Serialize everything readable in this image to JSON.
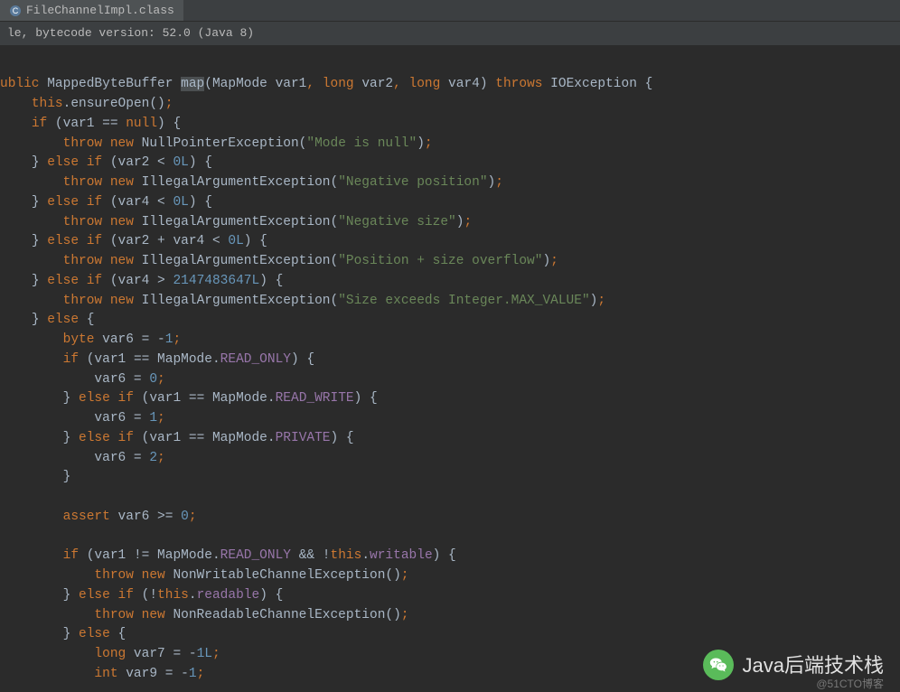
{
  "tab": {
    "filename": "FileChannelImpl.class"
  },
  "decompile_info": "le, bytecode version: 52.0 (Java 8)",
  "code": {
    "line1": {
      "kw1": "ublic",
      "type1": "MappedByteBuffer",
      "method": "map",
      "t1": "(MapMode var1",
      "kw2": ",",
      "t2": " long ",
      "v2": "var2",
      "t3": ", long ",
      "v3": "var4",
      "t4": ") ",
      "kw3": "throws",
      "t5": " IOException {"
    },
    "line2": {
      "kw1": "this",
      "t1": ".ensureOpen()",
      "p": ";"
    },
    "line3": {
      "kw1": "if",
      "t1": " (var1 == ",
      "kw2": "null",
      "t2": ") {"
    },
    "line4": {
      "kw1": "throw new",
      "t1": " NullPointerException(",
      "s1": "\"Mode is null\"",
      "t2": ")",
      "p": ";"
    },
    "line5": {
      "t1": "} ",
      "kw1": "else if",
      "t2": " (var2 < ",
      "n1": "0L",
      "t3": ") {"
    },
    "line6": {
      "kw1": "throw new",
      "t1": " IllegalArgumentException(",
      "s1": "\"Negative position\"",
      "t2": ")",
      "p": ";"
    },
    "line7": {
      "t1": "} ",
      "kw1": "else if",
      "t2": " (var4 < ",
      "n1": "0L",
      "t3": ") {"
    },
    "line8": {
      "kw1": "throw new",
      "t1": " IllegalArgumentException(",
      "s1": "\"Negative size\"",
      "t2": ")",
      "p": ";"
    },
    "line9": {
      "t1": "} ",
      "kw1": "else if",
      "t2": " (var2 + var4 < ",
      "n1": "0L",
      "t3": ") {"
    },
    "line10": {
      "kw1": "throw new",
      "t1": " IllegalArgumentException(",
      "s1": "\"Position + size overflow\"",
      "t2": ")",
      "p": ";"
    },
    "line11": {
      "t1": "} ",
      "kw1": "else if",
      "t2": " (var4 > ",
      "n1": "2147483647L",
      "t3": ") {"
    },
    "line12": {
      "kw1": "throw new",
      "t1": " IllegalArgumentException(",
      "s1": "\"Size exceeds Integer.MAX_VALUE\"",
      "t2": ")",
      "p": ";"
    },
    "line13": {
      "t1": "} ",
      "kw1": "else",
      "t2": " {"
    },
    "line14": {
      "kw1": "byte",
      "t1": " var6 = -",
      "n1": "1",
      "p": ";"
    },
    "line15": {
      "kw1": "if",
      "t1": " (var1 == MapMode.",
      "f1": "READ_ONLY",
      "t2": ") {"
    },
    "line16": {
      "t1": "var6 = ",
      "n1": "0",
      "p": ";"
    },
    "line17": {
      "t1": "} ",
      "kw1": "else if",
      "t2": " (var1 == MapMode.",
      "f1": "READ_WRITE",
      "t3": ") {"
    },
    "line18": {
      "t1": "var6 = ",
      "n1": "1",
      "p": ";"
    },
    "line19": {
      "t1": "} ",
      "kw1": "else if",
      "t2": " (var1 == MapMode.",
      "f1": "PRIVATE",
      "t3": ") {"
    },
    "line20": {
      "t1": "var6 = ",
      "n1": "2",
      "p": ";"
    },
    "line21": {
      "t1": "}"
    },
    "line22": {
      "t1": ""
    },
    "line23": {
      "kw1": "assert",
      "t1": " var6 >= ",
      "n1": "0",
      "p": ";"
    },
    "line24": {
      "t1": ""
    },
    "line25": {
      "kw1": "if",
      "t1": " (var1 != MapMode.",
      "f1": "READ_ONLY",
      "t2": " && !",
      "kw2": "this",
      "t3": ".",
      "f2": "writable",
      "t4": ") {"
    },
    "line26": {
      "kw1": "throw new",
      "t1": " NonWritableChannelException()",
      "p": ";"
    },
    "line27": {
      "t1": "} ",
      "kw1": "else if",
      "t2": " (!",
      "kw2": "this",
      "t3": ".",
      "f1": "readable",
      "t4": ") {"
    },
    "line28": {
      "kw1": "throw new",
      "t1": " NonReadableChannelException()",
      "p": ";"
    },
    "line29": {
      "t1": "} ",
      "kw1": "else",
      "t2": " {"
    },
    "line30": {
      "kw1": "long",
      "t1": " var7 = -",
      "n1": "1L",
      "p": ";"
    },
    "line31": {
      "kw1": "int",
      "t1": " var9 = -",
      "n1": "1",
      "p": ";"
    }
  },
  "watermark": {
    "text": "Java后端技术栈",
    "sub": "@51CTO博客"
  }
}
